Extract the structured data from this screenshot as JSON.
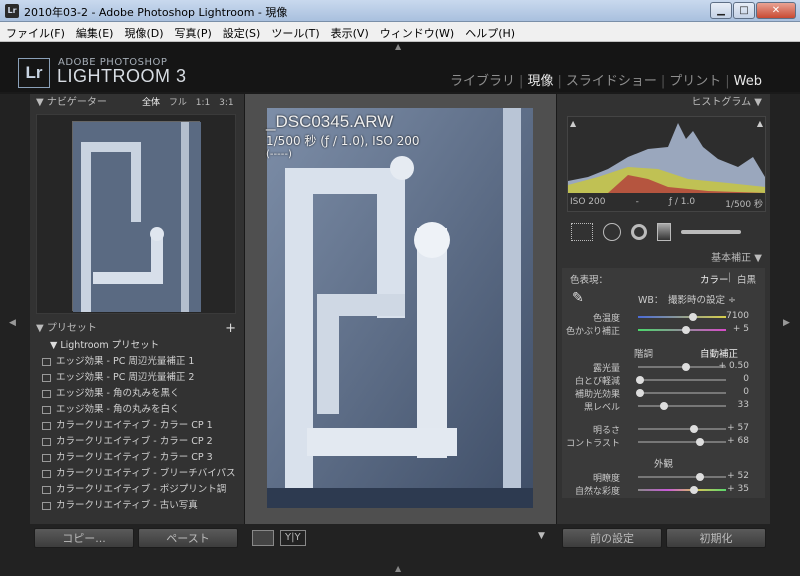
{
  "window": {
    "title": "2010年03-2 - Adobe Photoshop Lightroom - 現像",
    "app_icon": "Lr",
    "buttons": [
      "▁",
      "□",
      "✕"
    ]
  },
  "menu": [
    "ファイル(F)",
    "編集(E)",
    "現像(D)",
    "写真(P)",
    "設定(S)",
    "ツール(T)",
    "表示(V)",
    "ウィンドウ(W)",
    "ヘルプ(H)"
  ],
  "header": {
    "logo": "Lr",
    "brand_top": "ADOBE PHOTOSHOP",
    "brand_name": "LIGHTROOM 3"
  },
  "modules": [
    {
      "label": "ライブラリ",
      "active": false
    },
    {
      "label": "現像",
      "active": true
    },
    {
      "label": "スライドショー",
      "active": false
    },
    {
      "label": "プリント",
      "active": false
    },
    {
      "label": "Web",
      "active": false
    }
  ],
  "navigator": {
    "title": "ナビゲーター",
    "zoom_options": [
      "全体",
      "フル",
      "1:1",
      "3:1 ÷"
    ]
  },
  "presets": {
    "title": "プリセット",
    "add": "+",
    "group": "Lightroom プリセット",
    "items": [
      "エッジ効果 - PC 周辺光量補正 1",
      "エッジ効果 - PC 周辺光量補正 2",
      "エッジ効果 - 角の丸みを黒く",
      "エッジ効果 - 角の丸みを白く",
      "カラークリエイティブ - カラー CP 1",
      "カラークリエイティブ - カラー CP 2",
      "カラークリエイティブ - カラー CP 3",
      "カラークリエイティブ - ブリーチバイパス",
      "カラークリエイティブ - ポジプリント調",
      "カラークリエイティブ - 古い写真"
    ]
  },
  "photo": {
    "filename": "_DSC0345.ARW",
    "exposure": "1/500 秒 (ƒ / 1.0), ISO 200",
    "lens": "(-----)"
  },
  "histogram": {
    "title": "ヒストグラム",
    "iso": "ISO 200",
    "dash": "-",
    "aperture": "ƒ / 1.0",
    "shutter": "1/500 秒"
  },
  "basic": {
    "title": "基本補正",
    "treatment_label": "色表現：",
    "treatment_color": "カラー",
    "treatment_bw": "白黒",
    "wb_label": "WB：",
    "wb_value": "撮影時の設定 ÷",
    "tone_title": "階調",
    "auto_tone": "自動補正",
    "presence_title": "外観",
    "sliders": [
      {
        "label": "色温度",
        "value": "7100",
        "level": 0.62
      },
      {
        "label": "色かぶり補正",
        "value": "+ 5",
        "level": 0.55
      },
      {
        "label": "露光量",
        "value": "+ 0.50",
        "level": 0.55
      },
      {
        "label": "白とび軽減",
        "value": "0",
        "level": 0.02
      },
      {
        "label": "補助光効果",
        "value": "0",
        "level": 0.02
      },
      {
        "label": "黒レベル",
        "value": "33",
        "level": 0.3
      },
      {
        "label": "明るさ",
        "value": "+ 57",
        "level": 0.64
      },
      {
        "label": "コントラスト",
        "value": "+ 68",
        "level": 0.7
      },
      {
        "label": "明瞭度",
        "value": "+ 52",
        "level": 0.7
      },
      {
        "label": "自然な彩度",
        "value": "+ 35",
        "level": 0.64
      }
    ]
  },
  "bottom": {
    "copy": "コピー...",
    "paste": "ペースト",
    "previous": "前の設定",
    "reset": "初期化",
    "view_yy": "Y|Y"
  }
}
